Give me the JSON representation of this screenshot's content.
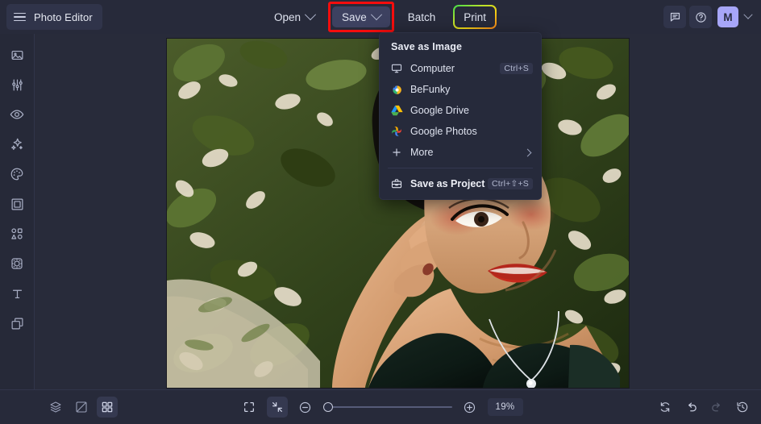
{
  "app": {
    "title": "Photo Editor",
    "accent_purple": "#a7a6f8",
    "highlight_red": "#f60d0d",
    "panel_bg": "#272a3a"
  },
  "header": {
    "brand_label": "Photo Editor",
    "tools": [
      {
        "label": "Open",
        "has_caret": true,
        "state": "normal"
      },
      {
        "label": "Save",
        "has_caret": true,
        "state": "active-highlighted"
      },
      {
        "label": "Batch",
        "has_caret": false,
        "state": "normal"
      },
      {
        "label": "Print",
        "has_caret": false,
        "state": "gradient-outline"
      }
    ],
    "right_icons": [
      {
        "name": "feedback-icon",
        "label": "Feedback"
      },
      {
        "name": "help-icon",
        "label": "Help"
      }
    ],
    "avatar_initial": "M"
  },
  "sidebar": {
    "items": [
      {
        "name": "sidebar-item-image",
        "icon": "image-icon",
        "label": "Image Manager"
      },
      {
        "name": "sidebar-item-edit",
        "icon": "sliders-icon",
        "label": "Edit"
      },
      {
        "name": "sidebar-item-touchup",
        "icon": "eye-icon",
        "label": "Touch Up"
      },
      {
        "name": "sidebar-item-effects",
        "icon": "sparkles-icon",
        "label": "Effects"
      },
      {
        "name": "sidebar-item-artsy",
        "icon": "palette-icon",
        "label": "Artsy"
      },
      {
        "name": "sidebar-item-frames",
        "icon": "frame-icon",
        "label": "Frames"
      },
      {
        "name": "sidebar-item-graphics",
        "icon": "shapes-icon",
        "label": "Graphics"
      },
      {
        "name": "sidebar-item-overlays",
        "icon": "badge-icon",
        "label": "Overlays"
      },
      {
        "name": "sidebar-item-text",
        "icon": "text-icon",
        "label": "Text"
      },
      {
        "name": "sidebar-item-textures",
        "icon": "layers-stack-icon",
        "label": "Textures"
      }
    ]
  },
  "menu": {
    "title": "Save as Image",
    "items": [
      {
        "label": "Computer",
        "icon": "monitor-icon",
        "shortcut": "Ctrl+S",
        "submenu": false
      },
      {
        "label": "BeFunky",
        "icon": "befunky-logo-icon",
        "shortcut": "",
        "submenu": false
      },
      {
        "label": "Google Drive",
        "icon": "google-drive-icon",
        "shortcut": "",
        "submenu": false
      },
      {
        "label": "Google Photos",
        "icon": "google-photos-icon",
        "shortcut": "",
        "submenu": false
      },
      {
        "label": "More",
        "icon": "plus-icon",
        "shortcut": "",
        "submenu": true
      }
    ],
    "footer": {
      "label": "Save as Project",
      "icon": "briefcase-icon",
      "shortcut": "Ctrl+⇧+S"
    }
  },
  "bottombar": {
    "left_icons": [
      {
        "name": "layers-button",
        "icon": "layers-icon",
        "active": false
      },
      {
        "name": "compare-button",
        "icon": "compare-icon",
        "active": false
      },
      {
        "name": "grid-button",
        "icon": "grid-icon",
        "active": true
      }
    ],
    "view_icons": [
      {
        "name": "fit-screen-button",
        "icon": "expand-frame-icon",
        "active": false
      },
      {
        "name": "shrink-button",
        "icon": "collapse-arrows-icon",
        "active": true
      }
    ],
    "zoom_out_icon": "minus-circle-icon",
    "zoom_in_icon": "plus-circle-icon",
    "zoom_value": "19%",
    "zoom_slider_percent": 0,
    "right_icons": [
      {
        "name": "reset-button",
        "icon": "reset-icon",
        "active": false,
        "dim": false
      },
      {
        "name": "undo-button",
        "icon": "undo-icon",
        "active": false,
        "dim": false
      },
      {
        "name": "redo-button",
        "icon": "redo-icon",
        "active": false,
        "dim": true
      },
      {
        "name": "history-button",
        "icon": "history-icon",
        "active": false,
        "dim": false
      }
    ]
  },
  "canvas": {
    "image_alt": "Stylized cartoon illustration of a woman with curly hair and red lipstick lying among green foliage and pale blossoms, wearing a dark off-shoulder top and a thin silver pendant necklace"
  }
}
